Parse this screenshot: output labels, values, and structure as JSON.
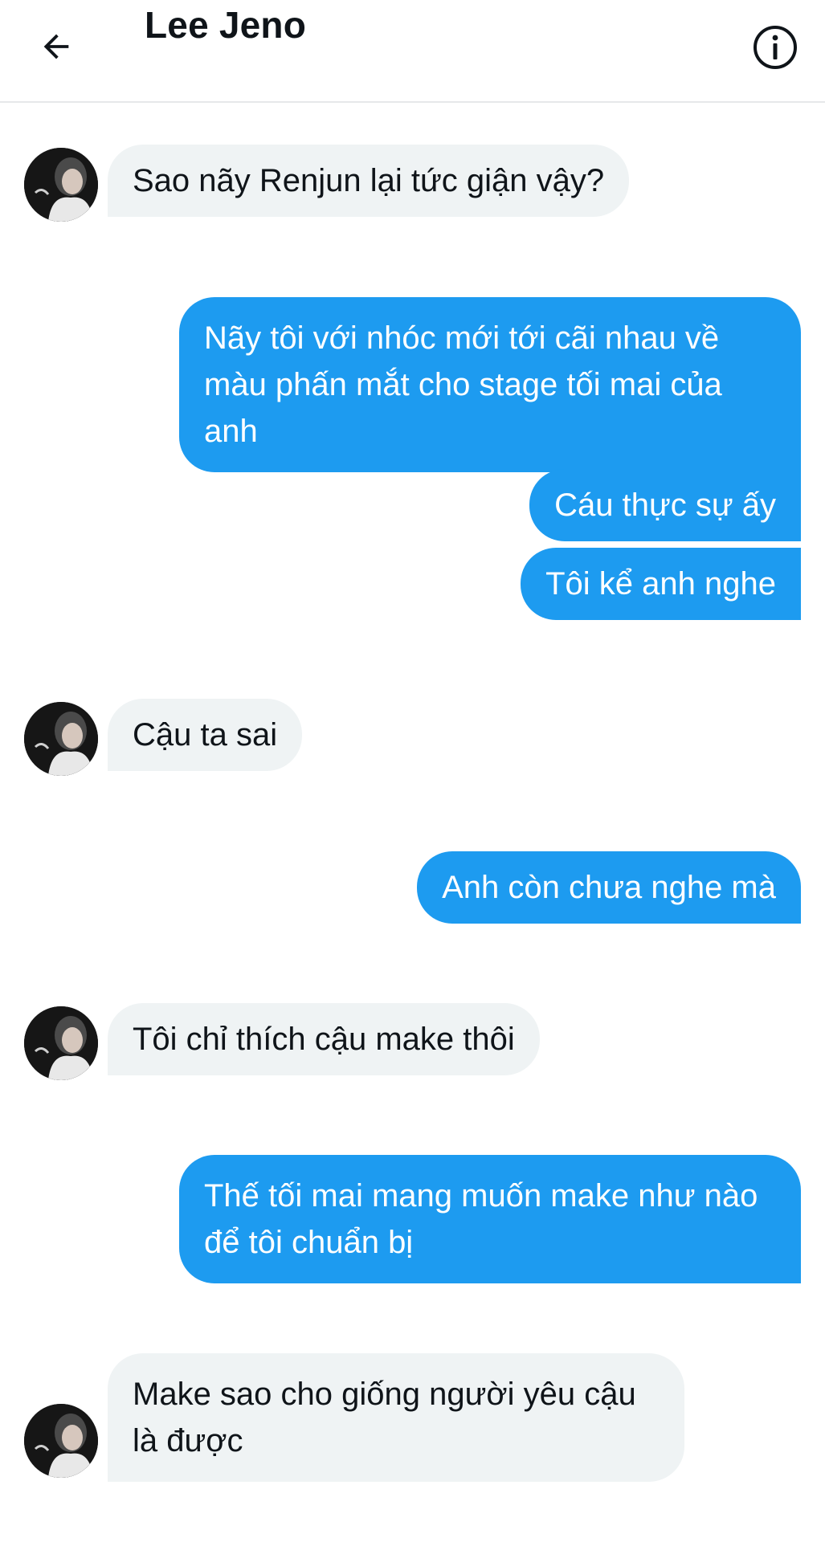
{
  "header": {
    "title": "Lee Jeno",
    "back_icon": "arrow-left-icon",
    "info_icon": "info-circle-icon"
  },
  "colors": {
    "outgoing_bubble": "#1d9bf0",
    "incoming_bubble": "#eff3f4",
    "text_dark": "#0f1419"
  },
  "messages": [
    {
      "direction": "in",
      "text": "Sao nãy Renjun lại tức giận vậy?"
    },
    {
      "direction": "out",
      "text": "Nãy tôi với nhóc mới tới cãi nhau về màu phấn mắt cho stage tối mai của anh"
    },
    {
      "direction": "out",
      "text": "Cáu thực sự ấy"
    },
    {
      "direction": "out",
      "text": "Tôi kể anh nghe"
    },
    {
      "direction": "in",
      "text": "Cậu ta sai"
    },
    {
      "direction": "out",
      "text": "Anh còn chưa nghe mà"
    },
    {
      "direction": "in",
      "text": "Tôi chỉ thích cậu make thôi"
    },
    {
      "direction": "out",
      "text": "Thế tối mai mang muốn make như nào để tôi chuẩn bị"
    },
    {
      "direction": "in",
      "text": "Make sao cho giống người yêu cậu là được"
    }
  ]
}
